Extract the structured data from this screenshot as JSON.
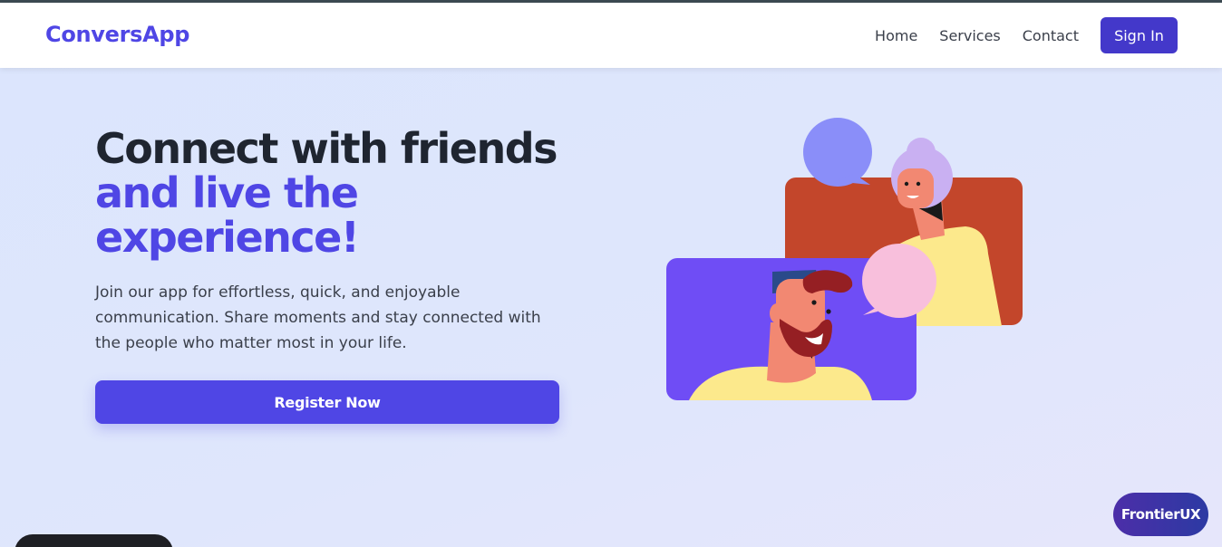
{
  "header": {
    "logo": "ConversApp",
    "nav": [
      "Home",
      "Services",
      "Contact"
    ],
    "signin_label": "Sign In"
  },
  "hero": {
    "title_line1": "Connect with friends",
    "title_line2": "and live the",
    "title_line3": "experience!",
    "description": "Join our app for effortless, quick, and enjoyable communication. Share moments and stay connected with the people who matter most in your life.",
    "cta_label": "Register Now"
  },
  "badge": {
    "label": "FrontierUX"
  },
  "colors": {
    "accent": "#4f46e5",
    "signin": "#4338ca",
    "heading": "#1f2530",
    "background": "#dbe5fd"
  },
  "icons": [
    "speech-bubble-blue-icon",
    "speech-bubble-pink-icon"
  ]
}
